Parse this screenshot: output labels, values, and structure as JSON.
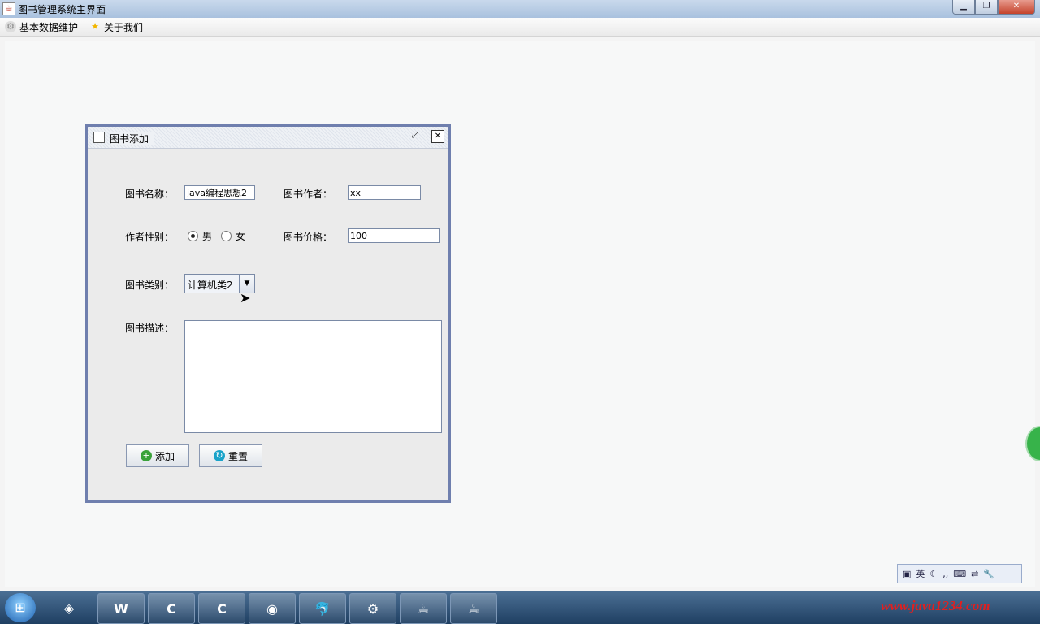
{
  "window": {
    "title": "图书管理系统主界面",
    "icon": "java-icon",
    "controls": [
      "minimize",
      "maximize",
      "close"
    ]
  },
  "menubar": {
    "items": [
      {
        "label": "基本数据维护",
        "icon": "gear-icon"
      },
      {
        "label": "关于我们",
        "icon": "star-icon"
      }
    ]
  },
  "frame": {
    "title": "图书添加",
    "form": {
      "name_label": "图书名称：",
      "name_value": "java编程思想2",
      "author_label": "图书作者：",
      "author_value": "xx",
      "gender_label": "作者性别：",
      "gender_male": "男",
      "gender_female": "女",
      "gender_selected": "男",
      "price_label": "图书价格：",
      "price_value": "100",
      "category_label": "图书类别：",
      "category_value": "计算机类2",
      "desc_label": "图书描述：",
      "desc_value": ""
    },
    "buttons": {
      "add": "添加",
      "reset": "重置"
    }
  },
  "ime": {
    "labels": [
      "英"
    ]
  },
  "taskbar": {
    "items": [
      "W",
      "C",
      "C"
    ]
  },
  "watermark": "www.java1234.com",
  "colors": {
    "frame_border": "#6f7fae",
    "add_icon": "#3aa23a",
    "reset_icon": "#1aa3c9",
    "watermark": "#e02020"
  }
}
